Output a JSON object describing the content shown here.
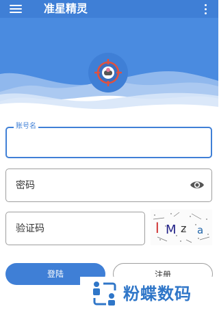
{
  "appbar": {
    "title": "准星精灵",
    "menu_icon": "hamburger-menu-icon",
    "overflow_icon": "more-vert-icon",
    "color": "#3f7fd6"
  },
  "logo": {
    "icon": "crosshair-target-icon"
  },
  "form": {
    "account": {
      "label": "账号名",
      "value": ""
    },
    "password": {
      "placeholder": "密码",
      "toggle_icon": "eye-icon"
    },
    "captcha": {
      "placeholder": "验证码",
      "image_text": "l Mz a"
    }
  },
  "buttons": {
    "login": "登陆",
    "register": "注册"
  },
  "watermark": {
    "text": "粉蝶数码",
    "icon": "watermark-logo-icon"
  }
}
